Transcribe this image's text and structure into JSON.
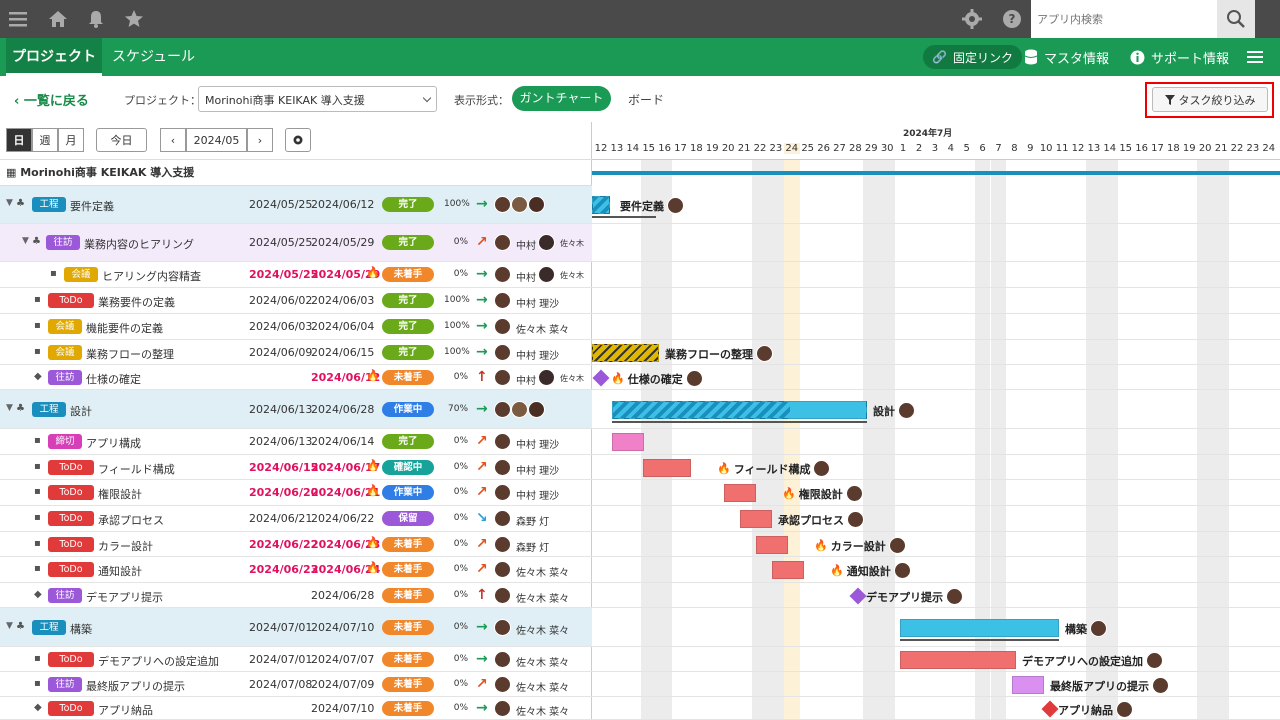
{
  "topbar": {
    "search_placeholder": "アプリ内検索",
    "icons": [
      "menu-icon",
      "home-icon",
      "bell-icon",
      "star-icon",
      "gear-icon",
      "help-icon",
      "search-icon"
    ]
  },
  "nav": {
    "tabs": [
      "プロジェクト",
      "スケジュール"
    ],
    "fixed_link": "固定リンク",
    "master": "マスタ情報",
    "support": "サポート情報"
  },
  "controls": {
    "back": "一覧に戻る",
    "project_label": "プロジェクト：",
    "project_value": "Morinohi商事 KEIKAK 導入支援",
    "display_label": "表示形式：",
    "gantt": "ガントチャート",
    "board": "ボード",
    "filter": "タスク絞り込み"
  },
  "toolbar": {
    "views": [
      "日",
      "週",
      "月"
    ],
    "today": "今日",
    "month": "2024/05"
  },
  "project_title": "Morinohi商事 KEIKAK 導入支援",
  "timeline": {
    "days_june": [
      "12",
      "13",
      "14",
      "15",
      "16",
      "17",
      "18",
      "19",
      "20",
      "21",
      "22",
      "23",
      "24",
      "25",
      "26",
      "27",
      "28",
      "29",
      "30"
    ],
    "days_july": [
      "1",
      "2",
      "3",
      "4",
      "5",
      "6",
      "7",
      "8",
      "9",
      "10",
      "11",
      "12",
      "13",
      "14",
      "15",
      "16",
      "17",
      "18",
      "19",
      "20",
      "21",
      "22",
      "23",
      "24"
    ],
    "month_label": "2024年7月"
  },
  "rows": [
    {
      "type": "工程",
      "tcolor": "#1a8fbd",
      "name": "要件定義",
      "start": "2024/05/25",
      "end": "2024/06/12",
      "status": "完了",
      "scolor": "#6aaa1a",
      "pct": "100",
      "arrow": "→",
      "acolor": "#1a9a55",
      "assignee": "",
      "kind": "phase",
      "indent": 0,
      "red": false
    },
    {
      "type": "往訪",
      "tcolor": "#9b59d9",
      "name": "業務内容のヒアリング",
      "start": "2024/05/25",
      "end": "2024/05/29",
      "status": "完了",
      "scolor": "#6aaa1a",
      "pct": "0",
      "arrow": "↗",
      "acolor": "#e0531a",
      "assignee": "中村",
      "assignee2": "佐々木",
      "kind": "sub",
      "indent": 1,
      "red": false
    },
    {
      "type": "会議",
      "tcolor": "#e0a800",
      "name": "ヒアリング内容精査",
      "start": "2024/05/25",
      "end": "2024/05/29",
      "status": "未着手",
      "scolor": "#f0872a",
      "pct": "0",
      "arrow": "→",
      "acolor": "#1a9a55",
      "assignee": "中村",
      "assignee2": "佐々木",
      "kind": "task",
      "indent": 2,
      "red": true
    },
    {
      "type": "ToDo",
      "tcolor": "#e03a3a",
      "name": "業務要件の定義",
      "start": "2024/06/02",
      "end": "2024/06/03",
      "status": "完了",
      "scolor": "#6aaa1a",
      "pct": "100",
      "arrow": "→",
      "acolor": "#1a9a55",
      "assignee": "中村 理沙",
      "kind": "task",
      "indent": 1,
      "red": false
    },
    {
      "type": "会議",
      "tcolor": "#e0a800",
      "name": "機能要件の定義",
      "start": "2024/06/03",
      "end": "2024/06/04",
      "status": "完了",
      "scolor": "#6aaa1a",
      "pct": "100",
      "arrow": "→",
      "acolor": "#1a9a55",
      "assignee": "佐々木 菜々",
      "kind": "task",
      "indent": 1,
      "red": false
    },
    {
      "type": "会議",
      "tcolor": "#e0a800",
      "name": "業務フローの整理",
      "start": "2024/06/09",
      "end": "2024/06/15",
      "status": "完了",
      "scolor": "#6aaa1a",
      "pct": "100",
      "arrow": "→",
      "acolor": "#1a9a55",
      "assignee": "中村 理沙",
      "kind": "task",
      "indent": 1,
      "red": false
    },
    {
      "type": "往訪",
      "tcolor": "#9b59d9",
      "name": "仕様の確定",
      "start": "",
      "end": "2024/06/12",
      "status": "未着手",
      "scolor": "#f0872a",
      "pct": "0",
      "arrow": "↑",
      "acolor": "#c0392b",
      "assignee": "中村",
      "assignee2": "佐々木",
      "kind": "task",
      "indent": 1,
      "red": true,
      "diamond": true
    },
    {
      "type": "工程",
      "tcolor": "#1a8fbd",
      "name": "設計",
      "start": "2024/06/13",
      "end": "2024/06/28",
      "status": "作業中",
      "scolor": "#2f7ee6",
      "pct": "70",
      "arrow": "→",
      "acolor": "#1a9a55",
      "assignee": "",
      "kind": "phase",
      "indent": 0,
      "red": false
    },
    {
      "type": "締切",
      "tcolor": "#d63fb7",
      "name": "アプリ構成",
      "start": "2024/06/13",
      "end": "2024/06/14",
      "status": "完了",
      "scolor": "#6aaa1a",
      "pct": "0",
      "arrow": "↗",
      "acolor": "#e0531a",
      "assignee": "中村 理沙",
      "kind": "task",
      "indent": 1,
      "red": false
    },
    {
      "type": "ToDo",
      "tcolor": "#e03a3a",
      "name": "フィールド構成",
      "start": "2024/06/15",
      "end": "2024/06/17",
      "status": "確認中",
      "scolor": "#17a39a",
      "pct": "0",
      "arrow": "↗",
      "acolor": "#e0531a",
      "assignee": "中村 理沙",
      "kind": "task",
      "indent": 1,
      "red": true
    },
    {
      "type": "ToDo",
      "tcolor": "#e03a3a",
      "name": "権限設計",
      "start": "2024/06/20",
      "end": "2024/06/21",
      "status": "作業中",
      "scolor": "#2f7ee6",
      "pct": "0",
      "arrow": "↗",
      "acolor": "#e0531a",
      "assignee": "中村 理沙",
      "kind": "task",
      "indent": 1,
      "red": true
    },
    {
      "type": "ToDo",
      "tcolor": "#e03a3a",
      "name": "承認プロセス",
      "start": "2024/06/21",
      "end": "2024/06/22",
      "status": "保留",
      "scolor": "#9b59d9",
      "pct": "0",
      "arrow": "↘",
      "acolor": "#2aa0d6",
      "assignee": "森野 灯",
      "kind": "task",
      "indent": 1,
      "red": false
    },
    {
      "type": "ToDo",
      "tcolor": "#e03a3a",
      "name": "カラー設計",
      "start": "2024/06/22",
      "end": "2024/06/23",
      "status": "未着手",
      "scolor": "#f0872a",
      "pct": "0",
      "arrow": "↗",
      "acolor": "#e0531a",
      "assignee": "森野 灯",
      "kind": "task",
      "indent": 1,
      "red": true
    },
    {
      "type": "ToDo",
      "tcolor": "#e03a3a",
      "name": "通知設計",
      "start": "2024/06/23",
      "end": "2024/06/24",
      "status": "未着手",
      "scolor": "#f0872a",
      "pct": "0",
      "arrow": "↗",
      "acolor": "#e0531a",
      "assignee": "佐々木 菜々",
      "kind": "task",
      "indent": 1,
      "red": true
    },
    {
      "type": "往訪",
      "tcolor": "#9b59d9",
      "name": "デモアプリ提示",
      "start": "",
      "end": "2024/06/28",
      "status": "未着手",
      "scolor": "#f0872a",
      "pct": "0",
      "arrow": "↑",
      "acolor": "#c0392b",
      "assignee": "佐々木 菜々",
      "kind": "task",
      "indent": 1,
      "red": false,
      "diamond": true
    },
    {
      "type": "工程",
      "tcolor": "#1a8fbd",
      "name": "構築",
      "start": "2024/07/01",
      "end": "2024/07/10",
      "status": "未着手",
      "scolor": "#f0872a",
      "pct": "0",
      "arrow": "→",
      "acolor": "#1a9a55",
      "assignee": "佐々木 菜々",
      "kind": "phase",
      "indent": 0,
      "red": false
    },
    {
      "type": "ToDo",
      "tcolor": "#e03a3a",
      "name": "デモアプリへの設定追加",
      "start": "2024/07/01",
      "end": "2024/07/07",
      "status": "未着手",
      "scolor": "#f0872a",
      "pct": "0",
      "arrow": "→",
      "acolor": "#1a9a55",
      "assignee": "佐々木 菜々",
      "kind": "task",
      "indent": 1,
      "red": false
    },
    {
      "type": "往訪",
      "tcolor": "#9b59d9",
      "name": "最終版アプリの提示",
      "start": "2024/07/08",
      "end": "2024/07/09",
      "status": "未着手",
      "scolor": "#f0872a",
      "pct": "0",
      "arrow": "↗",
      "acolor": "#e0531a",
      "assignee": "佐々木 菜々",
      "kind": "task",
      "indent": 1,
      "red": false
    },
    {
      "type": "ToDo",
      "tcolor": "#e03a3a",
      "name": "アプリ納品",
      "start": "",
      "end": "2024/07/10",
      "status": "未着手",
      "scolor": "#f0872a",
      "pct": "0",
      "arrow": "→",
      "acolor": "#1a9a55",
      "assignee": "佐々木 菜々",
      "kind": "task",
      "indent": 1,
      "red": false,
      "diamond": true
    }
  ],
  "bars": [
    {
      "label": "要件定義",
      "style": "stripe-blue"
    },
    {
      "label": "",
      "style": "none"
    },
    {
      "label": "",
      "style": "none"
    },
    {
      "label": "",
      "style": "none"
    },
    {
      "label": "",
      "style": "none"
    },
    {
      "label": "業務フローの整理",
      "style": "stripe-yellow"
    },
    {
      "label": "仕様の確定",
      "style": "diamond",
      "color": "#9b59d9"
    },
    {
      "label": "設計",
      "style": "stripe-blue"
    },
    {
      "label": "",
      "style": "pink"
    },
    {
      "label": "フィールド構成",
      "style": "red"
    },
    {
      "label": "権限設計",
      "style": "red"
    },
    {
      "label": "承認プロセス",
      "style": "red"
    },
    {
      "label": "カラー設計",
      "style": "red"
    },
    {
      "label": "通知設計",
      "style": "red"
    },
    {
      "label": "デモアプリ提示",
      "style": "diamond",
      "color": "#9b59d9"
    },
    {
      "label": "構築",
      "style": "blue"
    },
    {
      "label": "デモアプリへの設定追加",
      "style": "red"
    },
    {
      "label": "最終版アプリの提示",
      "style": "violet"
    },
    {
      "label": "アプリ納品",
      "style": "diamond",
      "color": "#e03a3a"
    }
  ],
  "colors": {
    "green": "#1a9a55",
    "topbar": "#4a4a4a",
    "today_col": "#fdf1d8",
    "weekend": "#e8e8e8"
  }
}
